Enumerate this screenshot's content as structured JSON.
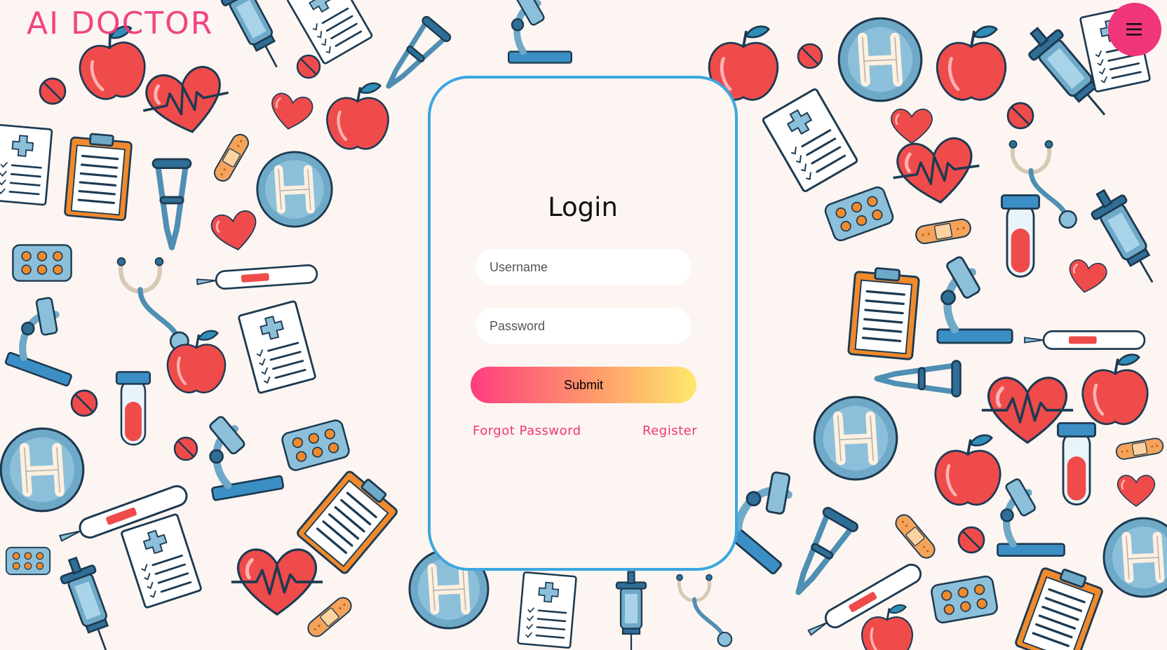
{
  "brand": {
    "name": "AI DOCTOR"
  },
  "menu": {
    "icon": "hamburger-icon",
    "color": "#f0357a"
  },
  "login": {
    "title": "Login",
    "username_placeholder": "Username",
    "password_placeholder": "Password",
    "submit_label": "Submit",
    "forgot_label": "Forgot Password",
    "register_label": "Register"
  },
  "theme": {
    "accent": "#f0357a",
    "card_border": "#3aa7e0",
    "background": "#fcf5f1",
    "gradient_start": "#ff3d7e",
    "gradient_end": "#ffe86b"
  },
  "background": {
    "pattern": "medical-doodle-pattern",
    "motifs": [
      "apple-icon",
      "heart-icon",
      "syringe-icon",
      "clipboard-icon",
      "microscope-icon",
      "stethoscope-icon",
      "hospital-sign-icon",
      "crutch-icon",
      "bandage-icon",
      "pill-icon",
      "test-tube-icon",
      "thermometer-icon",
      "pill-blister-icon",
      "medical-report-icon"
    ]
  }
}
